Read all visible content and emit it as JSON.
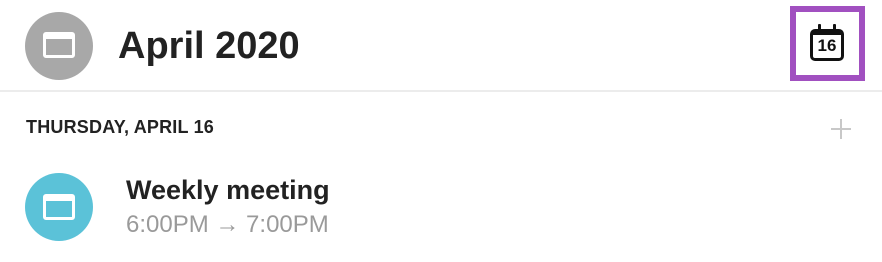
{
  "header": {
    "app_icon": "calendar-icon",
    "month_title": "April 2020",
    "today_button": {
      "icon": "calendar-today-icon",
      "day_number": "16",
      "highlight_color": "#a150c0"
    }
  },
  "agenda": {
    "day_header": "THURSDAY, APRIL 16",
    "add_icon": "plus-icon",
    "events": [
      {
        "icon": "calendar-icon",
        "icon_color": "#5bc2d8",
        "title": "Weekly meeting",
        "time": "6:00PM → 7:00PM"
      }
    ]
  }
}
